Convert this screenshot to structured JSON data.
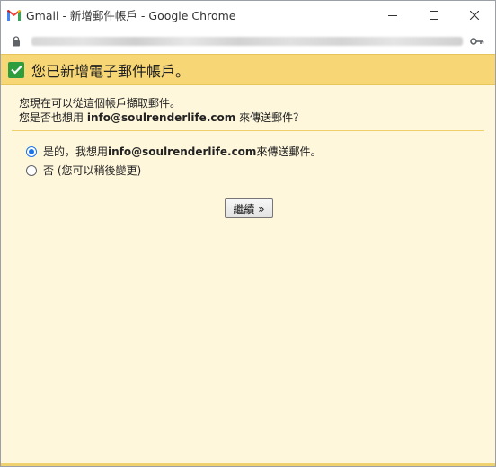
{
  "window": {
    "title": "Gmail - 新增郵件帳戶 - Google Chrome",
    "controls": [
      "minimize",
      "maximize",
      "close"
    ]
  },
  "address_bar": {
    "url_blurred": true
  },
  "header": {
    "title": "您已新增電子郵件帳戶。"
  },
  "content": {
    "line1": "您現在可以從這個帳戶擷取郵件。",
    "line2_prefix": "您是否也想用 ",
    "line2_email": "info@soulrenderlife.com",
    "line2_suffix": " 來傳送郵件？",
    "options": [
      {
        "prefix": "是的，我想用 ",
        "email": "info@soulrenderlife.com",
        "suffix": " 來傳送郵件。",
        "checked": true
      },
      {
        "label": "否 (您可以稍後變更)",
        "checked": false
      }
    ],
    "continue_label": "繼續 »"
  },
  "colors": {
    "header_bg": "#f6d675",
    "content_bg": "#fef7dc",
    "check_green": "#2e9d3e",
    "radio_blue": "#1a73e8"
  }
}
